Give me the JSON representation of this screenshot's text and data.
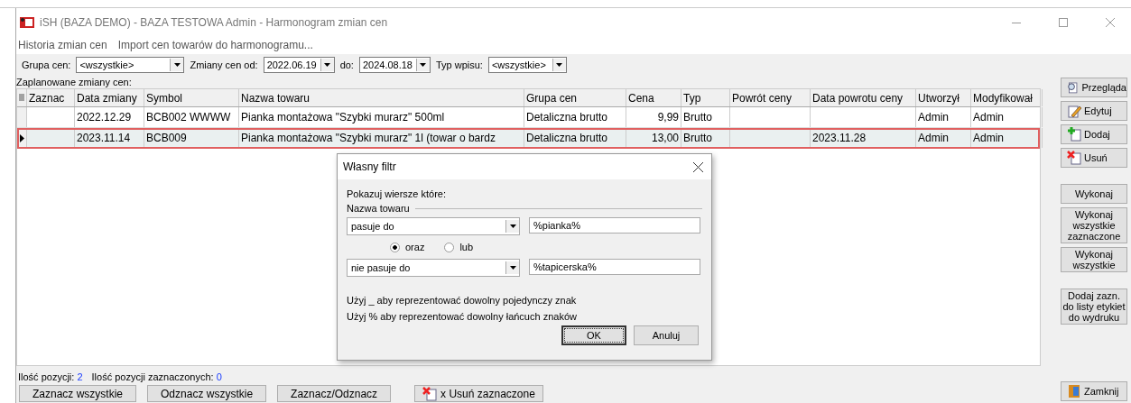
{
  "window": {
    "title": "iSH (BAZA DEMO) - BAZA TESTOWA  Admin - Harmonogram zmian cen"
  },
  "menu": [
    "Historia zmian cen",
    "Import cen towarów do harmonogramu..."
  ],
  "filters": [
    {
      "label": "Grupa cen:",
      "kind": "combo",
      "value": "<wszystkie>"
    },
    {
      "label": "Zmiany cen od:",
      "kind": "date",
      "value": "2022.06.19"
    },
    {
      "label": "do:",
      "kind": "date",
      "value": "2024.08.18"
    },
    {
      "label": "Typ wpisu:",
      "kind": "combo",
      "value": "<wszystkie>"
    }
  ],
  "section_label": "Zaplanowane zmiany cen:",
  "table": {
    "columns": [
      "Zaznac",
      "Data zmiany",
      "Symbol",
      "Nazwa towaru",
      "Grupa cen",
      "Cena",
      "Typ",
      "Powrót ceny",
      "Data powrotu ceny",
      "Utworzył",
      "Modyfikował"
    ],
    "rows": [
      {
        "selected": false,
        "cells": [
          "",
          "2022.12.29",
          "BCB002 WWWW",
          "Pianka montażowa \"Szybki murarz\" 500ml",
          "Detaliczna brutto",
          "9,99",
          "Brutto",
          "",
          "",
          "Admin",
          "Admin"
        ]
      },
      {
        "selected": true,
        "cells": [
          "",
          "2023.11.14",
          "BCB009",
          "Pianka montażowa \"Szybki murarz\" 1l (towar o bardz",
          "Detaliczna brutto",
          "13,00",
          "Brutto",
          "",
          "2023.11.28",
          "Admin",
          "Admin"
        ]
      }
    ]
  },
  "side_buttons": [
    {
      "label": "Przegląda",
      "kind": "view"
    },
    {
      "label": "Edytuj",
      "kind": "edit"
    },
    {
      "label": "Dodaj",
      "kind": "add"
    },
    {
      "label": "Usuń",
      "kind": "delete"
    },
    {
      "label": "Wykonaj",
      "kind": "text"
    },
    {
      "label": "Wykonaj wszystkie zaznaczone",
      "kind": "text"
    },
    {
      "label": "Wykonaj wszystkie",
      "kind": "text"
    },
    {
      "label": "Dodaj zazn. do listy etykiet do wydruku",
      "kind": "text"
    }
  ],
  "status": [
    {
      "label": "Ilość pozycji:",
      "value": "2"
    },
    {
      "label": "Ilość pozycji zaznaczonych:",
      "value": "0"
    }
  ],
  "bottom_buttons": [
    {
      "label": "Zaznacz wszystkie",
      "kind": "text"
    },
    {
      "label": "Odznacz wszystkie",
      "kind": "text"
    },
    {
      "label": "Zaznacz/Odznacz",
      "kind": "text"
    },
    {
      "label": "x Usuń zaznaczone",
      "kind": "delete"
    }
  ],
  "close_button": {
    "label": "Zamknij"
  },
  "dialog": {
    "title": "Własny filtr",
    "intro": "Pokazuj wiersze które:",
    "group": "Nazwa towaru",
    "conditions": [
      {
        "operator": "pasuje do",
        "value": "%pianka%"
      },
      {
        "operator": "nie pasuje do",
        "value": "%tapicerska%"
      }
    ],
    "joins": [
      {
        "label": "oraz",
        "selected": true
      },
      {
        "label": "lub",
        "selected": false
      }
    ],
    "hints": [
      "Użyj _ aby reprezentować dowolny pojedynczy znak",
      "Użyj % aby reprezentować dowolny łańcuch znaków"
    ],
    "buttons": [
      {
        "label": "OK",
        "default": true
      },
      {
        "label": "Anuluj",
        "default": false
      }
    ]
  }
}
